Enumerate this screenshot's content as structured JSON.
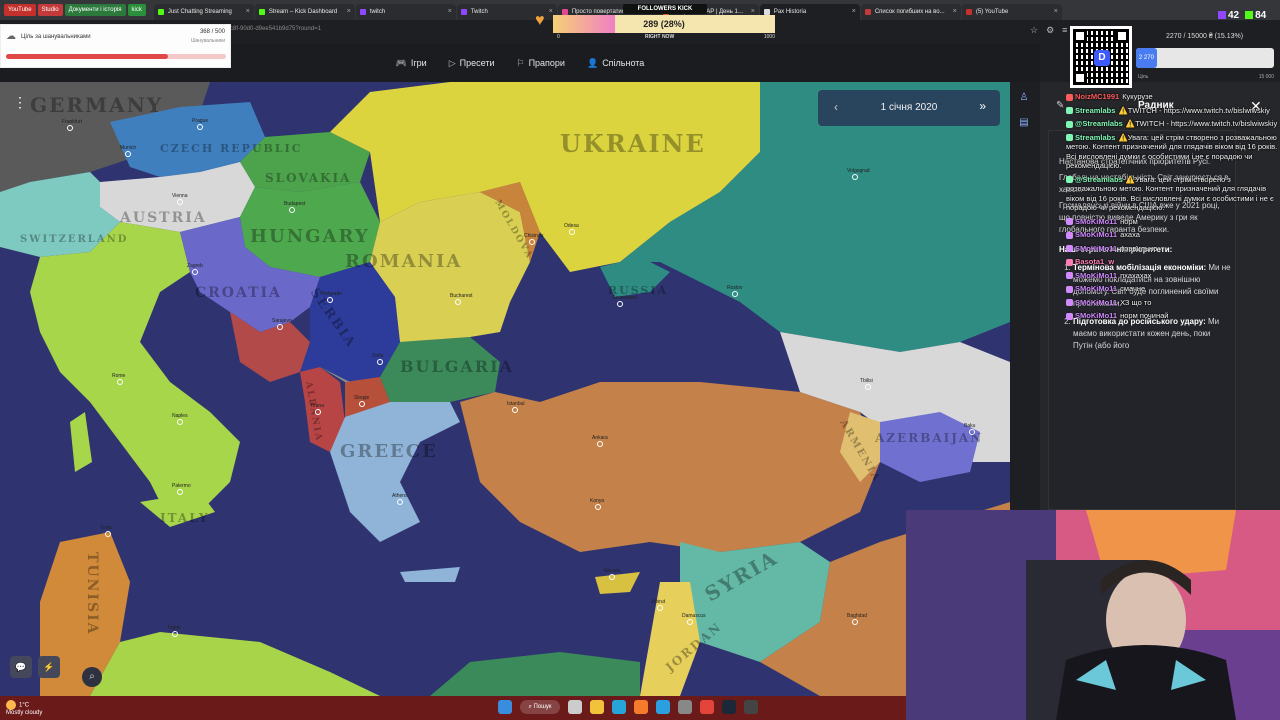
{
  "browser": {
    "bookmarks": [
      {
        "label": "YouTube",
        "color": "#c4302b"
      },
      {
        "label": "Studio",
        "color": "#c43a3a"
      },
      {
        "label": "Документи і історія",
        "color": "#2b7a3c"
      },
      {
        "label": "kick",
        "color": "#2b8f3c"
      }
    ],
    "tabs": [
      {
        "label": "Just Chatting Streaming",
        "color": "#53fc18"
      },
      {
        "label": "Stream – Kick Dashboard",
        "color": "#53fc18"
      },
      {
        "label": "twitch",
        "color": "#9147ff"
      },
      {
        "label": "Twitch",
        "color": "#9147ff"
      },
      {
        "label": "Просто повертатися на по...",
        "color": "#e0458f"
      },
      {
        "label": "DeepStateMAP | День 1…",
        "color": "#e05a2c"
      },
      {
        "label": "Pax Historia",
        "color": "#ddd"
      },
      {
        "label": "Список погибших на во...",
        "color": "#c43a3a"
      },
      {
        "label": "(5) YouTube",
        "color": "#c4302b"
      }
    ],
    "active_tab_index": 6,
    "url": "c8f-90d0-d9ee541b9d75?round=1",
    "address_icons": [
      "☆",
      "⚙",
      "≡",
      "⋮"
    ]
  },
  "follower_goal": {
    "icon": "☁",
    "title": "Ціль за шанувальниками",
    "current": "368",
    "total": "500",
    "subtitle": "Шанувальники",
    "fraction": 0.736
  },
  "kick_goal": {
    "banner": "FOLLOWERS KICK",
    "value_text": "289 (28%)",
    "fraction": 0.28,
    "min_label": "0",
    "now_label": "RIGHT NOW",
    "max_label": "1000"
  },
  "topnav": {
    "items": [
      {
        "icon": "🎮",
        "label": "Ігри"
      },
      {
        "icon": "▷",
        "label": "Пресети"
      },
      {
        "icon": "⚐",
        "label": "Прапори"
      },
      {
        "icon": "👤",
        "label": "Спільнота"
      }
    ]
  },
  "map": {
    "date": "1 січня 2020",
    "prev_icon": "‹",
    "next_icon": "»",
    "menu_icon": "⋮",
    "search_icon": "⌕",
    "controls": [
      "💬",
      "⚡"
    ],
    "countries": [
      "GERMANY",
      "CZECH REPUBLIC",
      "SLOVAKIA",
      "AUSTRIA",
      "HUNGARY",
      "SWITZERLAND",
      "ROMANIA",
      "MOLDOVA",
      "UKRAINE",
      "CROATIA",
      "SERBIA",
      "BULGARIA",
      "RUSSIA",
      "ALBANIA",
      "GREECE",
      "ITALY",
      "TUNISIA",
      "SYRIA",
      "ARMENIA",
      "AZERBAIJAN",
      "JORDAN"
    ],
    "cities": [
      "Frankfurt",
      "Prague",
      "Munich",
      "Vienna",
      "Budapest",
      "Zagreb",
      "Belgrade",
      "Sarajevo",
      "Bucharest",
      "Chisinau",
      "Odesa",
      "Sevastopol",
      "Sofia",
      "Tirana",
      "Skopje",
      "Athens",
      "Istanbul",
      "Ankara",
      "Konya",
      "Rome",
      "Naples",
      "Palermo",
      "Tunis",
      "Tripoli",
      "Nicosia",
      "Beirut",
      "Damascus",
      "Baghdad",
      "Tbilisi",
      "Baku",
      "Volgograd",
      "Rostov"
    ]
  },
  "advisor": {
    "title": "Радник",
    "intro_lines": [
      "Настанова стратегічних пріоритетів Русі.",
      "Глобальна нестабільність Світ занурюється в хаос...",
      "Громадянські війни в США вже у 2021 році, що повністю виведе Америку з гри як глобального гаранта безпеки."
    ],
    "priorities_header": "Наші стратегічні пріоритети:",
    "priorities": [
      {
        "title": "Термінова мобілізація економіки:",
        "text": "Ми не можемо покладатися на зовнішню допомогу. Світ буде поглинений своїми проблемами."
      },
      {
        "title": "Підготовка до російського удару:",
        "text": "Ми маємо використати кожен день, поки Путін (або його"
      }
    ]
  },
  "chat": {
    "messages": [
      {
        "user": "NoizMC1991",
        "color": "#ff5c5c",
        "text": "Кукурузе"
      },
      {
        "user": "Streamlabs",
        "color": "#80f7b4",
        "text": "⚠️TWITCH - https://www.twitch.tv/bislwiwskiy"
      },
      {
        "user": "@Streamlabs",
        "color": "#80f7b4",
        "text": "⚠️TWITCH - https://www.twitch.tv/bislwiwskiy"
      },
      {
        "user": "Streamlabs",
        "color": "#80f7b4",
        "text": "⚠️Увага: цей стрім створено з розважальною метою. Контент призначений для глядачів віком від 16 років. Всі висловлені думки є особистими і не є порадою чи рекомендацією."
      },
      {
        "user": "@Streamlabs",
        "color": "#80f7b4",
        "text": "⚠️Увага: цей стрім створено з розважальною метою. Контент призначений для глядачів віком від 16 років. Всі висловлені думки є особистими і не є порадою чи рекомендацією."
      },
      {
        "user": "SMoKiMo11",
        "color": "#d18bff",
        "text": "норм"
      },
      {
        "user": "SMoKiMo11",
        "color": "#d18bff",
        "text": "ахаха"
      },
      {
        "user": "SMoKiMo11",
        "color": "#d18bff",
        "text": "правильно"
      },
      {
        "user": "Basota1_w",
        "color": "#ff7eb6",
        "text": ""
      },
      {
        "user": "SMoKiMo11",
        "color": "#d18bff",
        "text": "пхахахах"
      },
      {
        "user": "SMoKiMo11",
        "color": "#d18bff",
        "text": "смачне"
      },
      {
        "user": "SMoKiMo11",
        "color": "#d18bff",
        "text": "ХЗ що то"
      },
      {
        "user": "SMoKiMo11",
        "color": "#d18bff",
        "text": "норм починай"
      }
    ]
  },
  "tip_goal": {
    "text": "2270 / 15000 ₴ (15.13%)",
    "fraction": 0.1513,
    "fill_label": "2 270",
    "min_label": "Ціль",
    "max_label": "15 000"
  },
  "stream_stats": {
    "twitch_viewers": "42",
    "kick_viewers": "84"
  },
  "taskbar": {
    "weather_temp": "1°C",
    "weather_text": "Mostly cloudy",
    "search_label": "Пошук",
    "icons": [
      {
        "name": "windows-icon",
        "color": "#3a8dde"
      },
      {
        "name": "taskview-icon",
        "color": "#ccc"
      },
      {
        "name": "explorer-icon",
        "color": "#f3c23b"
      },
      {
        "name": "edge-icon",
        "color": "#27a4d8"
      },
      {
        "name": "firefox-icon",
        "color": "#f57a2c"
      },
      {
        "name": "telegram-icon",
        "color": "#2ba0e0"
      },
      {
        "name": "calculator-icon",
        "color": "#888"
      },
      {
        "name": "chrome-icon",
        "color": "#e3453a"
      },
      {
        "name": "steam-icon",
        "color": "#1b2838"
      },
      {
        "name": "obs-icon",
        "color": "#444"
      }
    ]
  }
}
